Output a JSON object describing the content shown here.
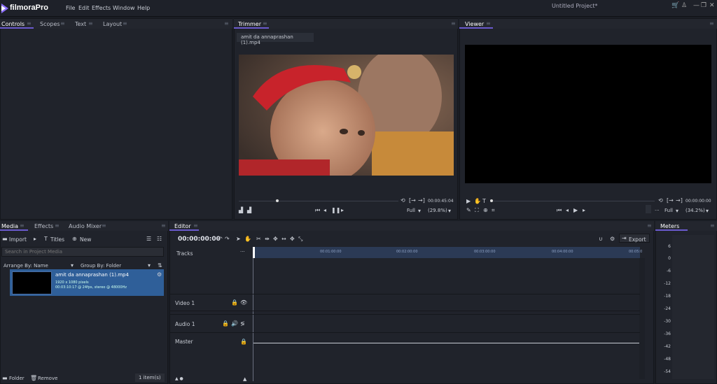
{
  "app": {
    "name": "filmoraPro",
    "project": "Untitled Project*"
  },
  "menu": [
    "File",
    "Edit",
    "Effects",
    "Window",
    "Help"
  ],
  "icons": {
    "cart": "cart-icon",
    "user": "user-icon",
    "min": "minimize-icon",
    "max": "maximize-icon",
    "close": "close-icon"
  },
  "left_tabs": [
    "Controls",
    "Scopes",
    "Text",
    "Layout"
  ],
  "trimmer": {
    "tab": "Trimmer",
    "file": "amit da annaprashan (1).mp4",
    "time": "00:00:45:04",
    "quality": "Full",
    "zoom": "(29.8%)"
  },
  "viewer": {
    "tab": "Viewer",
    "time": "00:00:00:00",
    "quality": "Full",
    "zoom": "(34.2%)"
  },
  "media": {
    "tabs": [
      "Media",
      "Effects",
      "Audio Mixer"
    ],
    "import": "Import",
    "titles": "Titles",
    "new": "New",
    "search_placeholder": "Search in Project Media",
    "arrange": "Arrange By: Name",
    "group": "Group By: Folder",
    "item": {
      "name": "amit da annaprashan (1).mp4",
      "line1": "1920 x 1080 pixels",
      "line2": "00:03:10:17 @ 24fps, stereo @ 48000Hz"
    },
    "folder": "Folder",
    "remove": "Remove",
    "count": "1 item(s)"
  },
  "editor": {
    "tab": "Editor",
    "time": "00:00:00:00",
    "export": "Export",
    "tracks_label": "Tracks",
    "ruler": [
      "00:01:00:00",
      "00:02:00:00",
      "00:03:00:00",
      "00:04:00:00",
      "00:05:0"
    ],
    "video_track": "Video 1",
    "audio_track": "Audio 1",
    "master": "Master"
  },
  "meters": {
    "tab": "Meters",
    "scale": [
      "6",
      "0",
      "-6",
      "-12",
      "-18",
      "-24",
      "-30",
      "-36",
      "-42",
      "-48",
      "-54"
    ]
  }
}
